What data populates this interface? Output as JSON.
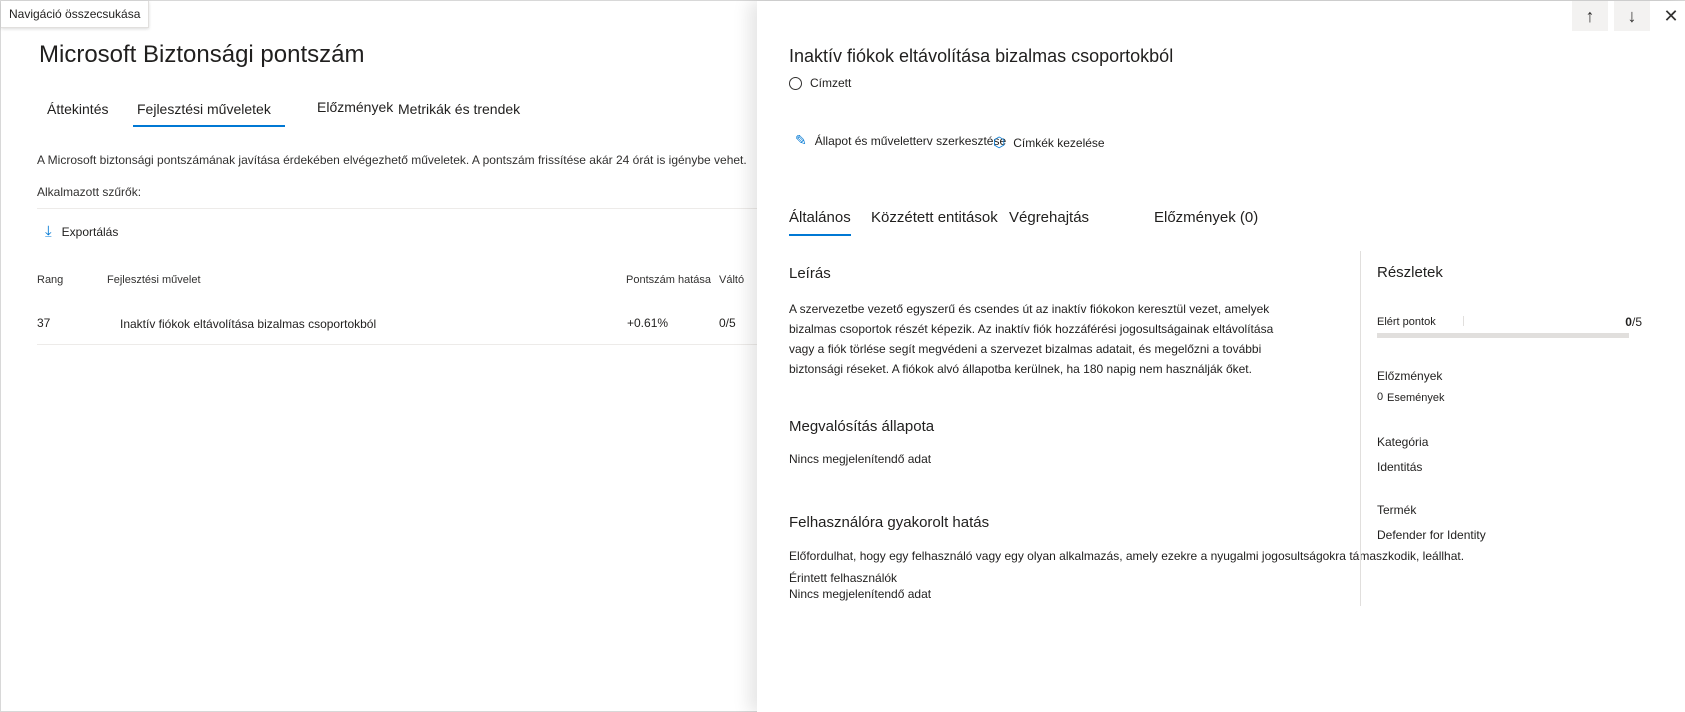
{
  "skip_link": "Navigáció összecsukása",
  "page_title": "Microsoft Biztonsági pontszám",
  "tabs": [
    "Áttekintés",
    "Fejlesztési műveletek",
    "Előzmények",
    "Metrikák és trendek"
  ],
  "intro_text": "A Microsoft biztonsági pontszámának javítása érdekében elvégezhető műveletek. A pontszám frissítése akár 24 órát is igénybe vehet.",
  "filters_label": "Alkalmazott szűrők:",
  "export_label": "Exportálás",
  "table": {
    "headers": [
      "Rang",
      "Fejlesztési művelet",
      "Pontszám hatása",
      "Váltó"
    ],
    "rows": [
      {
        "rank": "37",
        "action": "Inaktív fiókok eltávolítása bizalmas csoportokból",
        "impact": "+0.61%",
        "points": "0/5"
      }
    ]
  },
  "panel": {
    "title": "Inaktív fiókok eltávolítása bizalmas csoportokból",
    "assignee": "Címzett",
    "edit_action": "Állapot és műveletterv szerkesztése",
    "tags_action": "Címkék kezelése",
    "tabs": [
      "Általános",
      "Közzétett entitások",
      "Végrehajtás",
      "Előzmények (0)"
    ],
    "description_title": "Leírás",
    "description": "A szervezetbe vezető egyszerű és csendes út az inaktív fiókokon keresztül vezet, amelyek bizalmas csoportok részét képezik. Az inaktív fiók hozzáférési jogosultságainak eltávolítása vagy a fiók törlése segít megvédeni a szervezet bizalmas adatait, és megelőzni a további biztonsági réseket. A fiókok alvó állapotba kerülnek, ha 180 napig nem használják őket.",
    "implementation_title": "Megvalósítás állapota",
    "no_data": "Nincs megjelenítendő adat",
    "user_impact_title": "Felhasználóra gyakorolt hatás",
    "user_impact_text": "Előfordulhat, hogy egy felhasználó vagy egy olyan alkalmazás, amely ezekre a nyugalmi jogosultságokra támaszkodik, leállhat.",
    "affected_users_label": "Érintett felhasználók",
    "affected_users_value": "Nincs megjelenítendő adat",
    "details": {
      "title": "Részletek",
      "points_label": "Elért pontok",
      "points_value": "0",
      "points_max": "/5",
      "points_fraction": 0,
      "history_label": "Előzmények",
      "history_count": "0",
      "history_unit": "Események",
      "category_label": "Kategória",
      "category_value": "Identitás",
      "product_label": "Termék",
      "product_value": "Defender for Identity"
    }
  },
  "icons": {
    "up": "arrow-up-icon",
    "down": "arrow-down-icon",
    "close": "close-icon",
    "export": "download-icon",
    "edit": "pencil-icon",
    "tags": "tag-icon"
  },
  "colors": {
    "accent": "#0078d4"
  }
}
